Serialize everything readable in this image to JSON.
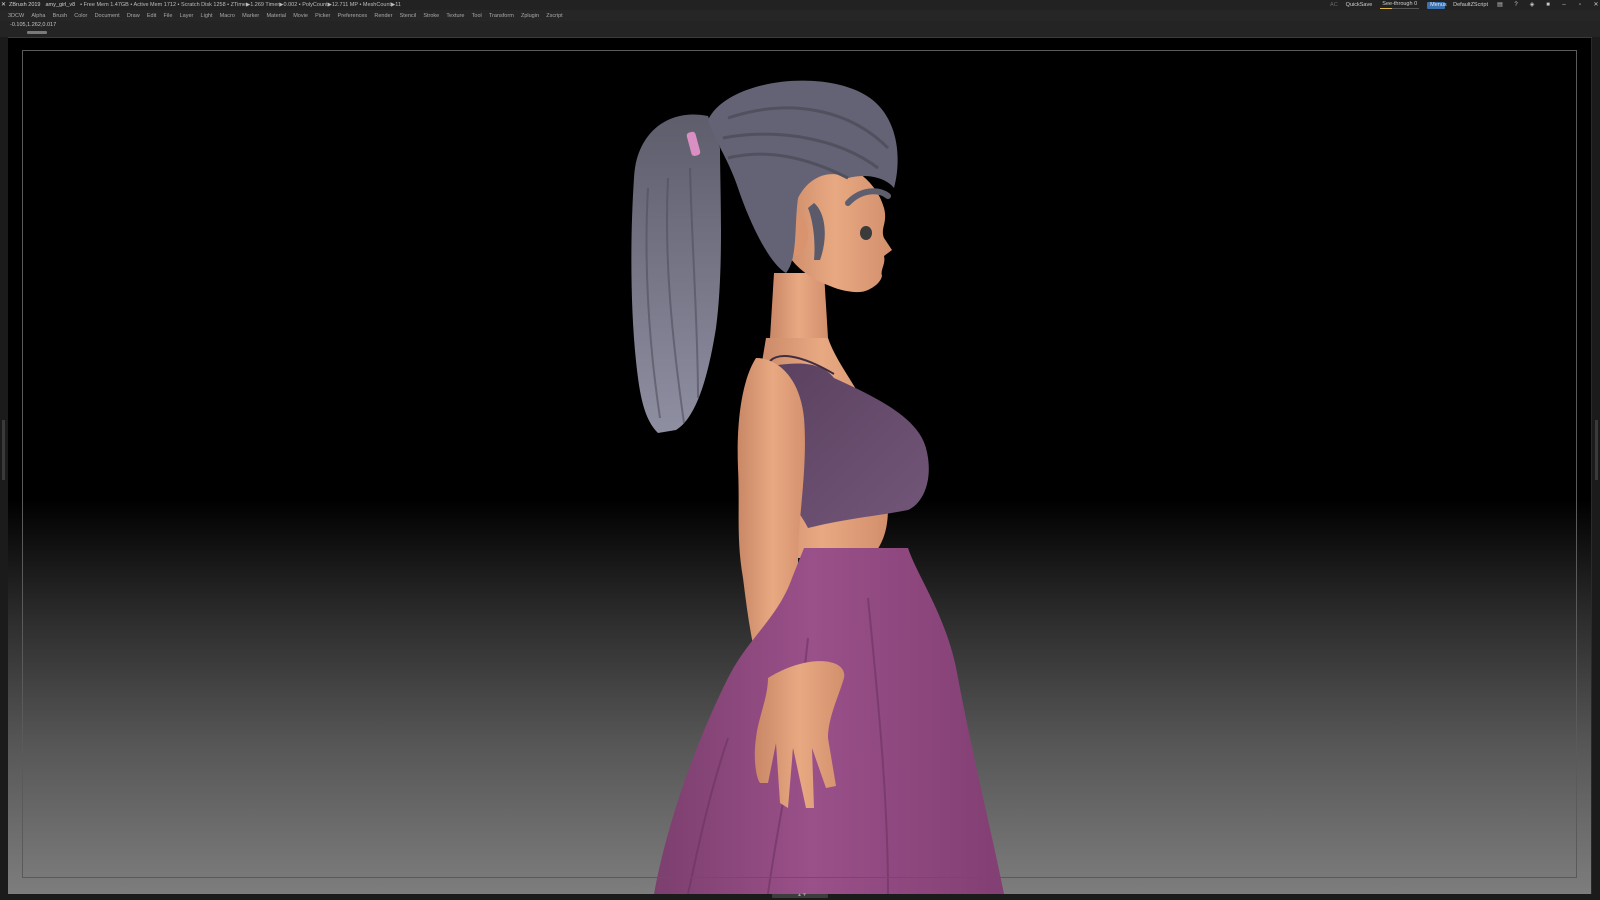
{
  "titlebar": {
    "app": "ZBrush 2019",
    "file": "amy_girl_v8",
    "stats": "• Free Mem 1.47GB • Active Mem 1712 • Scratch Disk 1258 • ZTime▶1.269 Timer▶0.002 • PolyCount▶12.711 MP • MeshCount▶11",
    "ac": "AC",
    "quicksave": "QuickSave",
    "seethrough": "See-through  0",
    "seethrough_level": 0,
    "menus": "Menus",
    "script": "DefaultZScript",
    "icons": [
      "layout-icon",
      "help-icon",
      "palette-icon",
      "lock-icon",
      "minimize-icon",
      "maximize-icon",
      "close-icon"
    ]
  },
  "menubar": {
    "items": [
      "3DCW",
      "Alpha",
      "Brush",
      "Color",
      "Document",
      "Draw",
      "Edit",
      "File",
      "Layer",
      "Light",
      "Macro",
      "Marker",
      "Material",
      "Movie",
      "Picker",
      "Preferences",
      "Render",
      "Stencil",
      "Stroke",
      "Texture",
      "Tool",
      "Transform",
      "Zplugin",
      "Zscript"
    ]
  },
  "coordbar": {
    "coords": "-0.105,1.262,0.017"
  },
  "colors": {
    "skin": "#e3a07c",
    "hair": "#6f6f80",
    "top": "#6a4e6e",
    "skirt": "#8e4a80",
    "hairtie": "#d98fc1",
    "menus_button": "#3a6fb0"
  }
}
